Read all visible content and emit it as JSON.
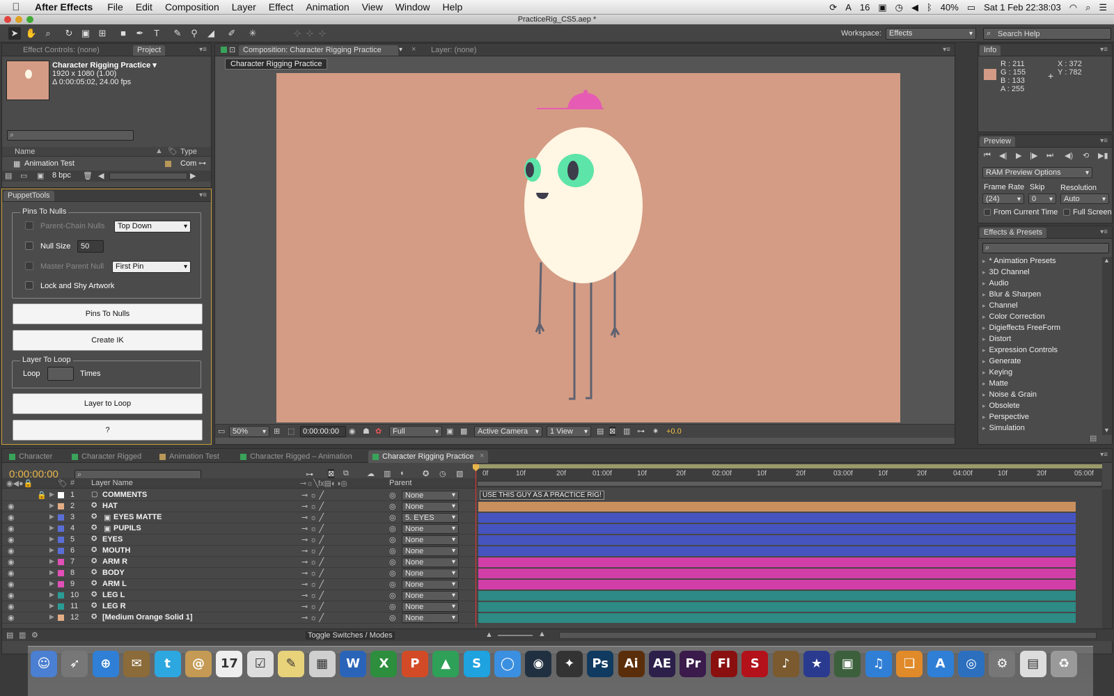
{
  "menubar": {
    "apple": "",
    "app_name": "After Effects",
    "items": [
      "File",
      "Edit",
      "Composition",
      "Layer",
      "Effect",
      "Animation",
      "View",
      "Window",
      "Help"
    ],
    "status": {
      "num": "16",
      "battery": "40%",
      "datetime": "Sat 1 Feb  22:38:03"
    }
  },
  "window": {
    "title": "PracticeRig_CS5.aep *"
  },
  "toolbar": {
    "workspace_label": "Workspace:",
    "workspace_value": "Effects",
    "search_placeholder": "Search Help"
  },
  "project": {
    "tabs": [
      "Effect Controls: (none)",
      "Project"
    ],
    "comp_name": "Character Rigging Practice ▾",
    "comp_size": "1920 x 1080 (1.00)",
    "comp_duration": "Δ 0:00:05:02, 24.00 fps",
    "col_name": "Name",
    "col_type": "Type",
    "item_name": "Animation Test",
    "item_type": "Com",
    "bpc": "8 bpc"
  },
  "puppet": {
    "tab": "PuppetTools",
    "group1_title": "Pins To Nulls",
    "parent_chain": "Parent-Chain Nulls",
    "parent_chain_option": "Top Down",
    "null_size_label": "Null Size",
    "null_size_value": "50",
    "master_parent": "Master Parent Null",
    "master_parent_option": "First Pin",
    "lock_shy": "Lock and Shy Artwork",
    "btn_pins": "Pins To Nulls",
    "btn_ik": "Create IK",
    "group2_title": "Layer To Loop",
    "loop_label": "Loop",
    "times_label": "Times",
    "btn_loop": "Layer to Loop",
    "btn_help": "?"
  },
  "composition": {
    "tab": "Composition: Character Rigging Practice",
    "layer_tab": "Layer: (none)",
    "breadcrumb": "Character Rigging Practice",
    "zoom": "50%",
    "timecode": "0:00:00:00",
    "resolution": "Full",
    "camera": "Active Camera",
    "view": "1 View",
    "exposure": "+0.0",
    "canvas_color": "#d49c85"
  },
  "info": {
    "tab": "Info",
    "r": "R : 211",
    "g": "G : 155",
    "b": "B : 133",
    "a": "A : 255",
    "x": "X : 372",
    "y": "Y : 782",
    "swatch": "#d39b85"
  },
  "preview": {
    "tab": "Preview",
    "ram_options": "RAM Preview Options",
    "frame_rate_label": "Frame Rate",
    "skip_label": "Skip",
    "resolution_label": "Resolution",
    "frame_rate": "(24)",
    "skip": "0",
    "resolution": "Auto",
    "from_current": "From Current Time",
    "full_screen": "Full Screen"
  },
  "effects": {
    "tab": "Effects & Presets",
    "items": [
      "* Animation Presets",
      "3D Channel",
      "Audio",
      "Blur & Sharpen",
      "Channel",
      "Color Correction",
      "Digieffects FreeForm",
      "Distort",
      "Expression Controls",
      "Generate",
      "Keying",
      "Matte",
      "Noise & Grain",
      "Obsolete",
      "Perspective",
      "Simulation"
    ]
  },
  "timeline": {
    "tabs": [
      {
        "label": "Character",
        "color": "#3aa35a"
      },
      {
        "label": "Character Rigged",
        "color": "#3aa35a"
      },
      {
        "label": "Animation Test",
        "color": "#b8975a"
      },
      {
        "label": "Character Rigged – Animation",
        "color": "#3aa35a"
      },
      {
        "label": "Character Rigging Practice",
        "color": "#3aa35a"
      }
    ],
    "timecode": "0:00:00:00",
    "col_num": "#",
    "col_layer": "Layer Name",
    "col_parent": "Parent",
    "ruler": [
      "0f",
      "10f",
      "20f",
      "01:00f",
      "10f",
      "20f",
      "02:00f",
      "10f",
      "20f",
      "03:00f",
      "10f",
      "20f",
      "04:00f",
      "10f",
      "20f",
      "05:00f"
    ],
    "toggle_label": "Toggle Switches / Modes",
    "comment_text": "USE THIS GUY AS A PRACTICE RIG!",
    "layers": [
      {
        "num": "1",
        "name": "COMMENTS",
        "label": "#ffffff",
        "parent": "None",
        "bar": ""
      },
      {
        "num": "2",
        "name": "HAT",
        "label": "#e4ad86",
        "parent": "None",
        "bar": "#c9905e"
      },
      {
        "num": "3",
        "name": "EYES MATTE",
        "label": "#5a6ed8",
        "parent": "5. EYES",
        "bar": "#4654c0"
      },
      {
        "num": "4",
        "name": "PUPILS",
        "label": "#5a6ed8",
        "parent": "None",
        "bar": "#4654c0"
      },
      {
        "num": "5",
        "name": "EYES",
        "label": "#5a6ed8",
        "parent": "None",
        "bar": "#4654c0"
      },
      {
        "num": "6",
        "name": "MOUTH",
        "label": "#5a6ed8",
        "parent": "None",
        "bar": "#4654c0"
      },
      {
        "num": "7",
        "name": "ARM R",
        "label": "#e24fb6",
        "parent": "None",
        "bar": "#d23ea7"
      },
      {
        "num": "8",
        "name": "BODY",
        "label": "#e24fb6",
        "parent": "None",
        "bar": "#d23ea7"
      },
      {
        "num": "9",
        "name": "ARM L",
        "label": "#e24fb6",
        "parent": "None",
        "bar": "#d23ea7"
      },
      {
        "num": "10",
        "name": "LEG L",
        "label": "#2a9c96",
        "parent": "None",
        "bar": "#2d8a85"
      },
      {
        "num": "11",
        "name": "LEG R",
        "label": "#2a9c96",
        "parent": "None",
        "bar": "#2d8a85"
      },
      {
        "num": "12",
        "name": "[Medium Orange Solid 1]",
        "label": "#e4ad86",
        "parent": "None",
        "bar": "#2d8a85"
      }
    ]
  },
  "dock": {
    "apps": [
      {
        "label": "☺",
        "color": "#4a7fd1"
      },
      {
        "label": "➶",
        "color": "#777777"
      },
      {
        "label": "⊕",
        "color": "#2f7fd6"
      },
      {
        "label": "✉",
        "color": "#8b6b3a"
      },
      {
        "label": "t",
        "color": "#2da7e0"
      },
      {
        "label": "@",
        "color": "#c49a54"
      },
      {
        "label": "17",
        "color": "#eeeeee"
      },
      {
        "label": "☑",
        "color": "#dddddd"
      },
      {
        "label": "✎",
        "color": "#e8d27a"
      },
      {
        "label": "▦",
        "color": "#cfcfcf"
      },
      {
        "label": "W",
        "color": "#2a64b8"
      },
      {
        "label": "X",
        "color": "#2d8e3d"
      },
      {
        "label": "P",
        "color": "#d34b26"
      },
      {
        "label": "▲",
        "color": "#2fa058"
      },
      {
        "label": "S",
        "color": "#1ea2e0"
      },
      {
        "label": "◯",
        "color": "#3b8fe0"
      },
      {
        "label": "◉",
        "color": "#203040"
      },
      {
        "label": "✦",
        "color": "#333333"
      },
      {
        "label": "Ps",
        "color": "#103a5f"
      },
      {
        "label": "Ai",
        "color": "#5a2e0a"
      },
      {
        "label": "AE",
        "color": "#2c1f4a"
      },
      {
        "label": "Pr",
        "color": "#3a1b4c"
      },
      {
        "label": "Fl",
        "color": "#8a1010"
      },
      {
        "label": "S",
        "color": "#b3121a"
      },
      {
        "label": "♪",
        "color": "#7a5a2e"
      },
      {
        "label": "★",
        "color": "#2a3b8f"
      },
      {
        "label": "▣",
        "color": "#3c5f3c"
      },
      {
        "label": "♫",
        "color": "#2f7fd6"
      },
      {
        "label": "❏",
        "color": "#e08a2a"
      },
      {
        "label": "A",
        "color": "#2f7fd6"
      },
      {
        "label": "◎",
        "color": "#2c6fbe"
      },
      {
        "label": "⚙",
        "color": "#777777"
      },
      {
        "label": "▤",
        "color": "#dddddd"
      },
      {
        "label": "♻",
        "color": "#9a9a9a"
      }
    ]
  }
}
